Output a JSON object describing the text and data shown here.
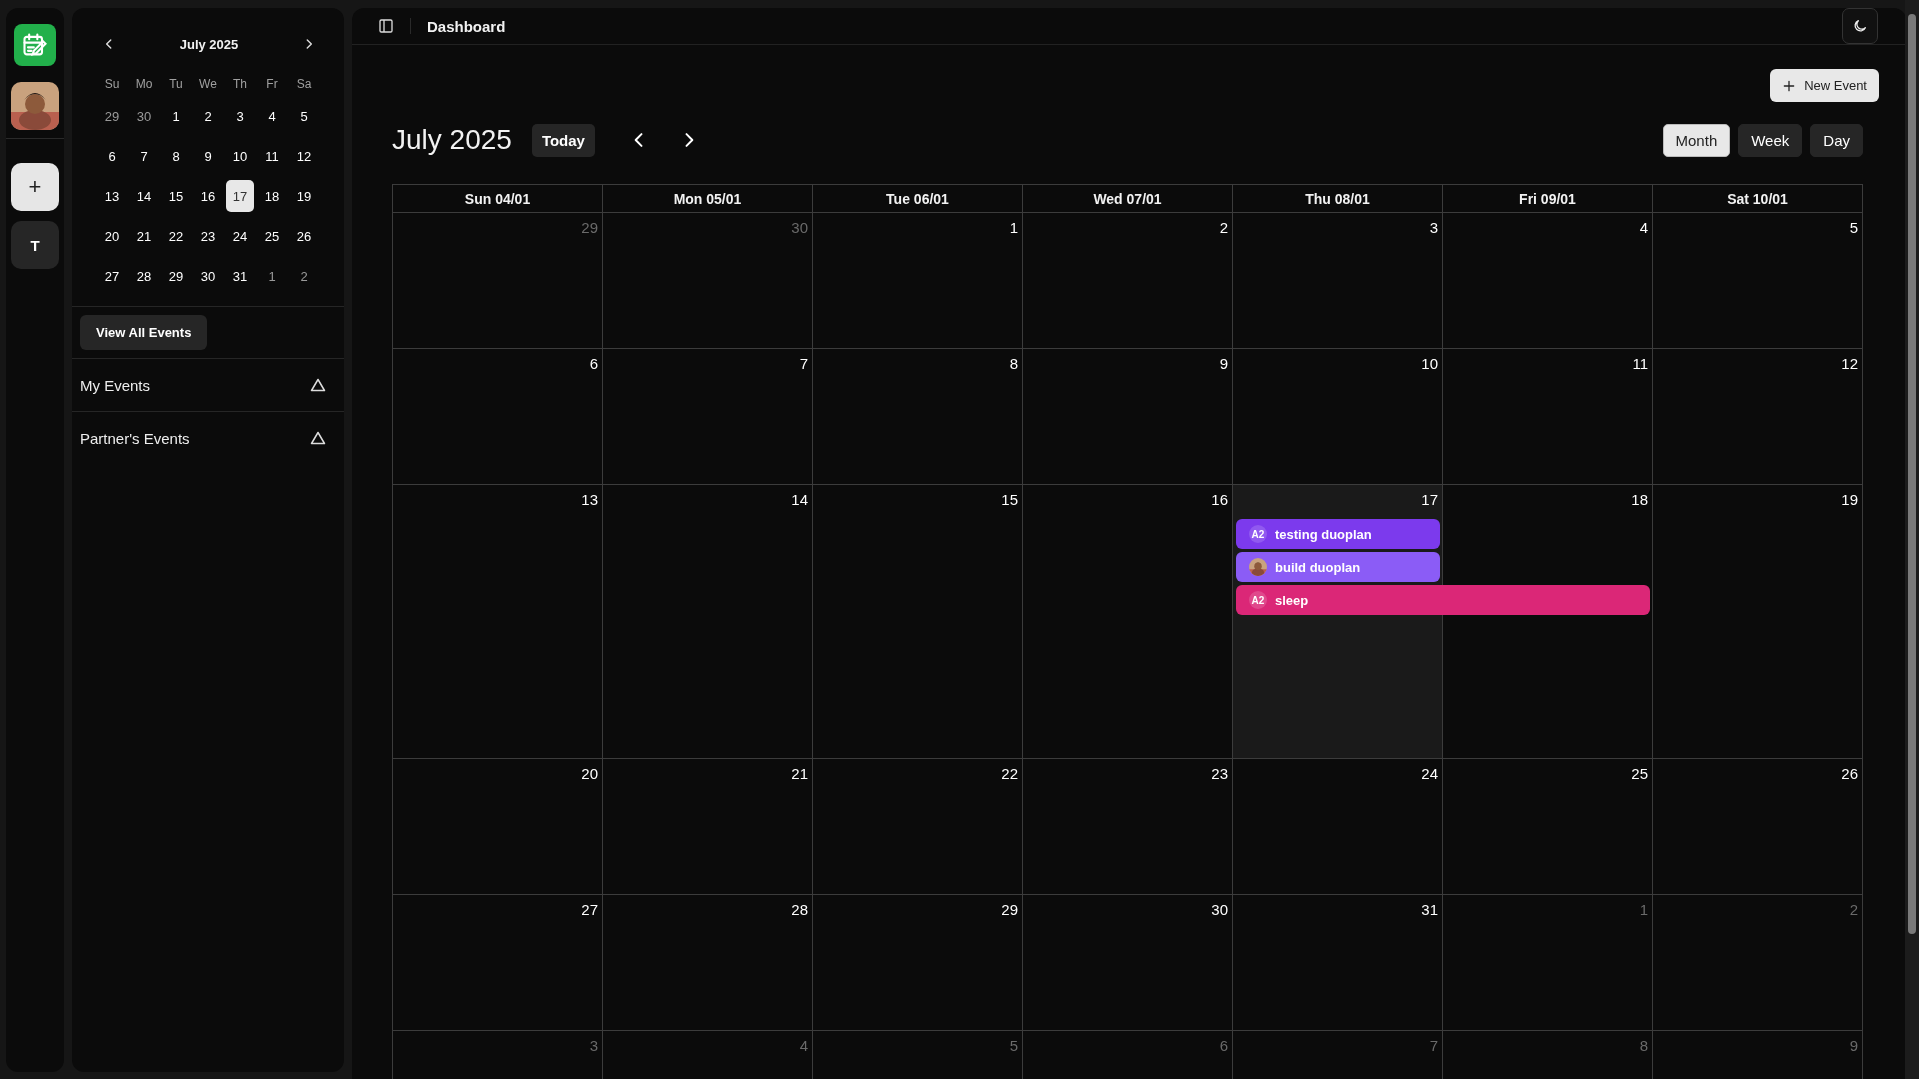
{
  "rail": {
    "items": [
      {
        "kind": "logo"
      },
      {
        "kind": "avatar"
      },
      {
        "kind": "add",
        "label": "+"
      },
      {
        "kind": "letter",
        "label": "T"
      }
    ]
  },
  "mini_calendar": {
    "title": "July 2025",
    "weekdays": [
      "Su",
      "Mo",
      "Tu",
      "We",
      "Th",
      "Fr",
      "Sa"
    ],
    "weeks": [
      [
        {
          "day": "29",
          "muted": true,
          "selected": false
        },
        {
          "day": "30",
          "muted": true,
          "selected": false
        },
        {
          "day": "1",
          "muted": false,
          "selected": false
        },
        {
          "day": "2",
          "muted": false,
          "selected": false
        },
        {
          "day": "3",
          "muted": false,
          "selected": false
        },
        {
          "day": "4",
          "muted": false,
          "selected": false
        },
        {
          "day": "5",
          "muted": false,
          "selected": false
        }
      ],
      [
        {
          "day": "6",
          "muted": false,
          "selected": false
        },
        {
          "day": "7",
          "muted": false,
          "selected": false
        },
        {
          "day": "8",
          "muted": false,
          "selected": false
        },
        {
          "day": "9",
          "muted": false,
          "selected": false
        },
        {
          "day": "10",
          "muted": false,
          "selected": false
        },
        {
          "day": "11",
          "muted": false,
          "selected": false
        },
        {
          "day": "12",
          "muted": false,
          "selected": false
        }
      ],
      [
        {
          "day": "13",
          "muted": false,
          "selected": false
        },
        {
          "day": "14",
          "muted": false,
          "selected": false
        },
        {
          "day": "15",
          "muted": false,
          "selected": false
        },
        {
          "day": "16",
          "muted": false,
          "selected": false
        },
        {
          "day": "17",
          "muted": false,
          "selected": true
        },
        {
          "day": "18",
          "muted": false,
          "selected": false
        },
        {
          "day": "19",
          "muted": false,
          "selected": false
        }
      ],
      [
        {
          "day": "20",
          "muted": false,
          "selected": false
        },
        {
          "day": "21",
          "muted": false,
          "selected": false
        },
        {
          "day": "22",
          "muted": false,
          "selected": false
        },
        {
          "day": "23",
          "muted": false,
          "selected": false
        },
        {
          "day": "24",
          "muted": false,
          "selected": false
        },
        {
          "day": "25",
          "muted": false,
          "selected": false
        },
        {
          "day": "26",
          "muted": false,
          "selected": false
        }
      ],
      [
        {
          "day": "27",
          "muted": false,
          "selected": false
        },
        {
          "day": "28",
          "muted": false,
          "selected": false
        },
        {
          "day": "29",
          "muted": false,
          "selected": false
        },
        {
          "day": "30",
          "muted": false,
          "selected": false
        },
        {
          "day": "31",
          "muted": false,
          "selected": false
        },
        {
          "day": "1",
          "muted": true,
          "selected": false
        },
        {
          "day": "2",
          "muted": true,
          "selected": false
        }
      ]
    ]
  },
  "view_all_button": "View All Events",
  "sections": [
    {
      "label": "My Events"
    },
    {
      "label": "Partner's Events"
    }
  ],
  "header": {
    "title": "Dashboard"
  },
  "toolbar": {
    "new_event": "New Event",
    "title": "July 2025",
    "today": "Today",
    "views": [
      {
        "label": "Month",
        "selected": true
      },
      {
        "label": "Week",
        "selected": false
      },
      {
        "label": "Day",
        "selected": false
      }
    ]
  },
  "calendar": {
    "columns": [
      "Sun 04/01",
      "Mon 05/01",
      "Tue 06/01",
      "Wed 07/01",
      "Thu 08/01",
      "Fri 09/01",
      "Sat 10/01"
    ],
    "weeks": [
      [
        {
          "day": "29",
          "muted": true,
          "today": false
        },
        {
          "day": "30",
          "muted": true,
          "today": false
        },
        {
          "day": "1",
          "muted": false,
          "today": false
        },
        {
          "day": "2",
          "muted": false,
          "today": false
        },
        {
          "day": "3",
          "muted": false,
          "today": false
        },
        {
          "day": "4",
          "muted": false,
          "today": false
        },
        {
          "day": "5",
          "muted": false,
          "today": false
        }
      ],
      [
        {
          "day": "6",
          "muted": false,
          "today": false
        },
        {
          "day": "7",
          "muted": false,
          "today": false
        },
        {
          "day": "8",
          "muted": false,
          "today": false
        },
        {
          "day": "9",
          "muted": false,
          "today": false
        },
        {
          "day": "10",
          "muted": false,
          "today": false
        },
        {
          "day": "11",
          "muted": false,
          "today": false
        },
        {
          "day": "12",
          "muted": false,
          "today": false
        }
      ],
      [
        {
          "day": "13",
          "muted": false,
          "today": false
        },
        {
          "day": "14",
          "muted": false,
          "today": false
        },
        {
          "day": "15",
          "muted": false,
          "today": false
        },
        {
          "day": "16",
          "muted": false,
          "today": false
        },
        {
          "day": "17",
          "muted": false,
          "today": true,
          "events": [
            {
              "title": "testing duoplan",
              "color": "#7c3aed",
              "avatar": {
                "kind": "initials",
                "text": "A2"
              },
              "spans_next_day": false
            },
            {
              "title": "build duoplan",
              "color": "#8b5cf6",
              "spans_next_day": false
            },
            {
              "title": "sleep",
              "color": "#db2777",
              "avatar": {
                "kind": "initials",
                "text": "A2"
              },
              "spans_next_day": true
            }
          ]
        },
        {
          "day": "18",
          "muted": false,
          "today": false
        },
        {
          "day": "19",
          "muted": false,
          "today": false
        }
      ],
      [
        {
          "day": "20",
          "muted": false,
          "today": false
        },
        {
          "day": "21",
          "muted": false,
          "today": false
        },
        {
          "day": "22",
          "muted": false,
          "today": false
        },
        {
          "day": "23",
          "muted": false,
          "today": false
        },
        {
          "day": "24",
          "muted": false,
          "today": false
        },
        {
          "day": "25",
          "muted": false,
          "today": false
        },
        {
          "day": "26",
          "muted": false,
          "today": false
        }
      ],
      [
        {
          "day": "27",
          "muted": false,
          "today": false
        },
        {
          "day": "28",
          "muted": false,
          "today": false
        },
        {
          "day": "29",
          "muted": false,
          "today": false
        },
        {
          "day": "30",
          "muted": false,
          "today": false
        },
        {
          "day": "31",
          "muted": false,
          "today": false
        },
        {
          "day": "1",
          "muted": true,
          "today": false
        },
        {
          "day": "2",
          "muted": true,
          "today": false
        }
      ],
      [
        {
          "day": "3",
          "muted": true,
          "today": false
        },
        {
          "day": "4",
          "muted": true,
          "today": false
        },
        {
          "day": "5",
          "muted": true,
          "today": false
        },
        {
          "day": "6",
          "muted": true,
          "today": false
        },
        {
          "day": "7",
          "muted": true,
          "today": false
        },
        {
          "day": "8",
          "muted": true,
          "today": false
        },
        {
          "day": "9",
          "muted": true,
          "today": false
        }
      ]
    ]
  }
}
